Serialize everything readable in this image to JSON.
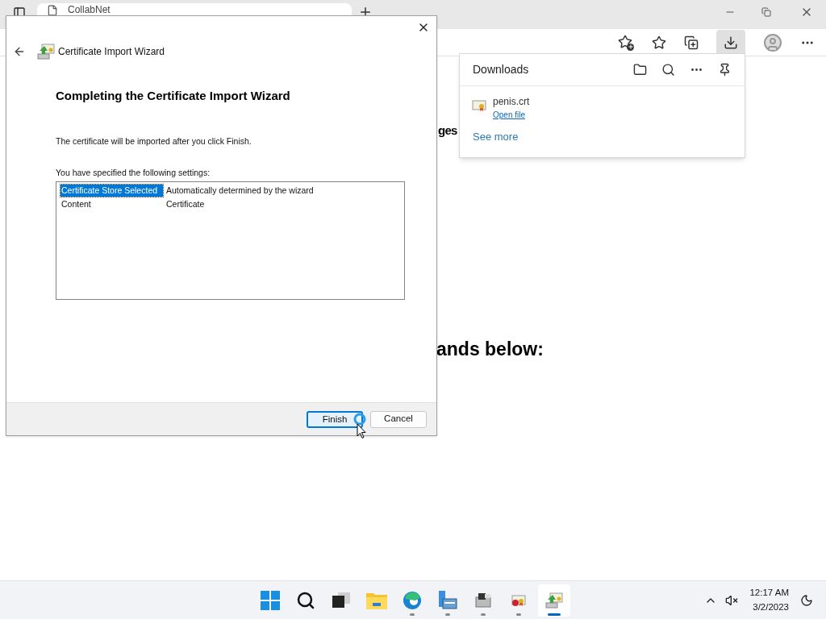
{
  "browser": {
    "tab": {
      "title": "CollabNet"
    },
    "page_texts": [
      {
        "text": "ges",
        "kind": "small"
      },
      {
        "text": "ands below:",
        "kind": "large"
      }
    ]
  },
  "downloads": {
    "title": "Downloads",
    "items": [
      {
        "name": "penis.crt",
        "action": "Open file"
      }
    ],
    "see_more": "See more"
  },
  "wizard": {
    "title": "Certificate Import Wizard",
    "heading": "Completing the Certificate Import Wizard",
    "message": "The certificate will be imported after you click Finish.",
    "settings_label": "You have specified the following settings:",
    "settings": [
      {
        "name": "Certificate Store Selected",
        "value": "Automatically determined by the wizard",
        "selected": true
      },
      {
        "name": "Content",
        "value": "Certificate",
        "selected": false
      }
    ],
    "buttons": [
      {
        "label": "Finish",
        "focused": true
      },
      {
        "label": "Cancel",
        "focused": false
      }
    ]
  },
  "taskbar": {
    "apps": [
      {
        "kind": "start",
        "running": false,
        "selected": false
      },
      {
        "kind": "search",
        "running": false,
        "selected": false
      },
      {
        "kind": "taskview",
        "running": false,
        "selected": false
      },
      {
        "kind": "explorer",
        "running": false,
        "selected": false
      },
      {
        "kind": "edge",
        "running": true,
        "selected": false
      },
      {
        "kind": "manager",
        "running": true,
        "selected": false
      },
      {
        "kind": "printer",
        "running": true,
        "selected": false
      },
      {
        "kind": "certerror",
        "running": true,
        "selected": false
      },
      {
        "kind": "certimport",
        "running": true,
        "selected": true
      }
    ],
    "time": "12:17 AM",
    "date": "3/2/2023"
  }
}
